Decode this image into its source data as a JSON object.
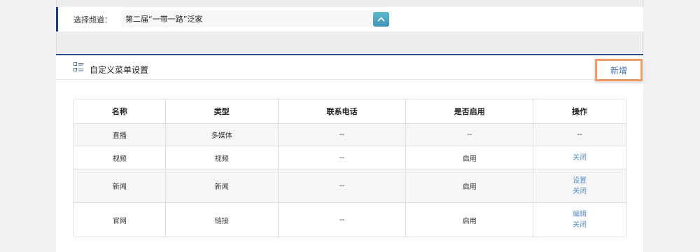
{
  "channel": {
    "label": "选择频道：",
    "value": "第二届“一带一路”泛家"
  },
  "panel": {
    "title": "自定义菜单设置",
    "add_button": "新增"
  },
  "table": {
    "headers": [
      "名称",
      "类型",
      "联系电话",
      "是否启用",
      "操作"
    ],
    "rows": [
      {
        "name": "直播",
        "type": "多媒体",
        "phone": "--",
        "enabled": "--",
        "actions": [
          "--"
        ]
      },
      {
        "name": "视频",
        "type": "视频",
        "phone": "--",
        "enabled": "启用",
        "actions": [
          "关闭"
        ]
      },
      {
        "name": "新闻",
        "type": "新闻",
        "phone": "--",
        "enabled": "启用",
        "actions": [
          "设置",
          "关闭"
        ]
      },
      {
        "name": "官网",
        "type": "链接",
        "phone": "--",
        "enabled": "启用",
        "actions": [
          "编辑",
          "关闭"
        ]
      }
    ]
  },
  "colors": {
    "accent_navy": "#1f3f82",
    "link_blue": "#5b8fc9",
    "highlight_orange": "#f29c64",
    "toggle_teal": "#4aa6c2"
  },
  "icons": {
    "toggle": "chevron-up-icon",
    "panel": "list-icon"
  }
}
